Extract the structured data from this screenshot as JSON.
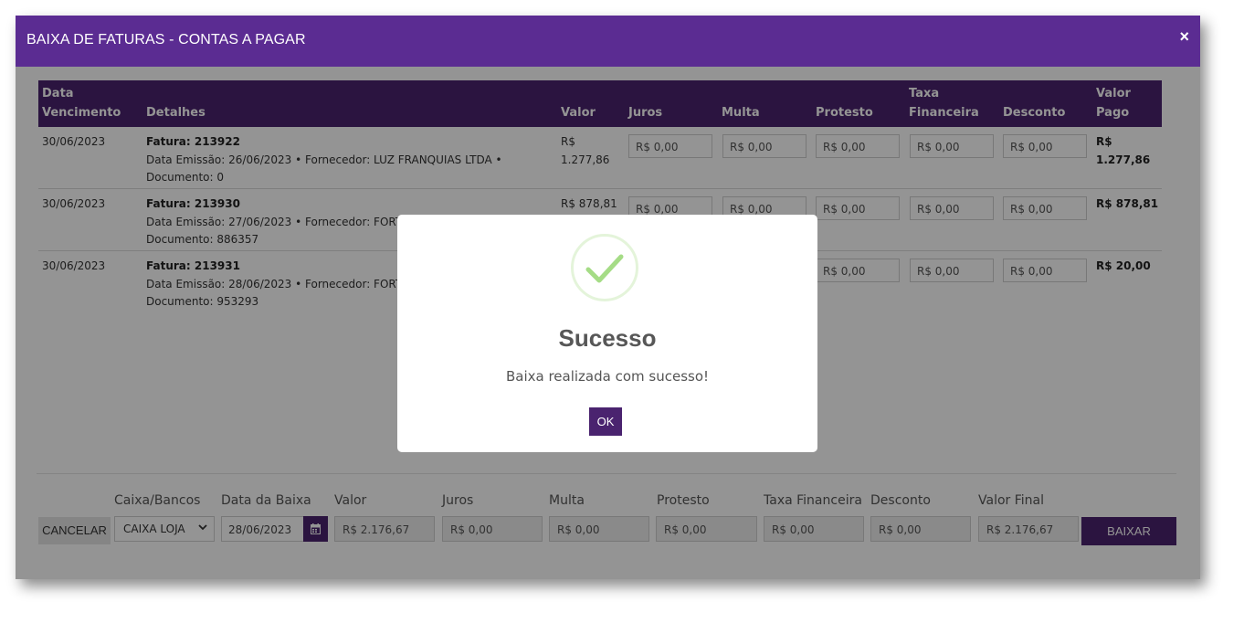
{
  "modal": {
    "title": "BAIXA DE FATURAS - CONTAS A PAGAR",
    "close_icon": "×"
  },
  "table": {
    "headers": {
      "data_vencimento": "Data\nVencimento",
      "detalhes": "Detalhes",
      "valor": "Valor",
      "juros": "Juros",
      "multa": "Multa",
      "protesto": "Protesto",
      "taxa": "Taxa\nFinanceira",
      "desconto": "Desconto",
      "valor_pago": "Valor\nPago"
    },
    "rows": [
      {
        "vencimento": "30/06/2023",
        "fatura": "Fatura: 213922",
        "detalhes": "Data Emissão: 26/06/2023 • Fornecedor: LUZ FRANQUIAS LTDA •",
        "documento": "Documento: 0",
        "valor": "R$\n1.277,86",
        "juros": "R$ 0,00",
        "multa": "R$ 0,00",
        "protesto": "R$ 0,00",
        "taxa": "R$ 0,00",
        "desconto": "R$ 0,00",
        "valor_pago": "R$\n1.277,86"
      },
      {
        "vencimento": "30/06/2023",
        "fatura": "Fatura: 213930",
        "detalhes": "Data Emissão: 27/06/2023 • Fornecedor: FORTU",
        "documento": "Documento: 886357",
        "valor": "R$ 878,81",
        "juros": "R$ 0,00",
        "multa": "R$ 0,00",
        "protesto": "R$ 0,00",
        "taxa": "R$ 0,00",
        "desconto": "R$ 0,00",
        "valor_pago": "R$ 878,81"
      },
      {
        "vencimento": "30/06/2023",
        "fatura": "Fatura: 213931",
        "detalhes": "Data Emissão: 28/06/2023 • Fornecedor: FORTU",
        "documento": "Documento: 953293",
        "protesto": "R$ 0,00",
        "taxa": "R$ 0,00",
        "desconto": "R$ 0,00",
        "valor_pago": "R$ 20,00"
      }
    ]
  },
  "footer": {
    "cancel_label": "CANCELAR",
    "labels": {
      "caixa": "Caixa/Bancos",
      "data": "Data da Baixa",
      "valor": "Valor",
      "juros": "Juros",
      "multa": "Multa",
      "protesto": "Protesto",
      "taxa": "Taxa Financeira",
      "desconto": "Desconto",
      "valor_final": "Valor Final"
    },
    "caixa_selected": "CAIXA LOJA",
    "data_value": "28/06/2023",
    "valor": "R$ 2.176,67",
    "juros": "R$ 0,00",
    "multa": "R$ 0,00",
    "protesto": "R$ 0,00",
    "taxa": "R$ 0,00",
    "desconto": "R$ 0,00",
    "valor_final": "R$ 2.176,67",
    "baixar_label": "BAIXAR"
  },
  "dialog": {
    "icon": "success-check-icon",
    "title": "Sucesso",
    "message": "Baixa realizada com sucesso!",
    "ok_label": "OK"
  },
  "colors": {
    "header": "#5b2c92",
    "accent": "#4a236f",
    "success": "#a5dc86"
  }
}
